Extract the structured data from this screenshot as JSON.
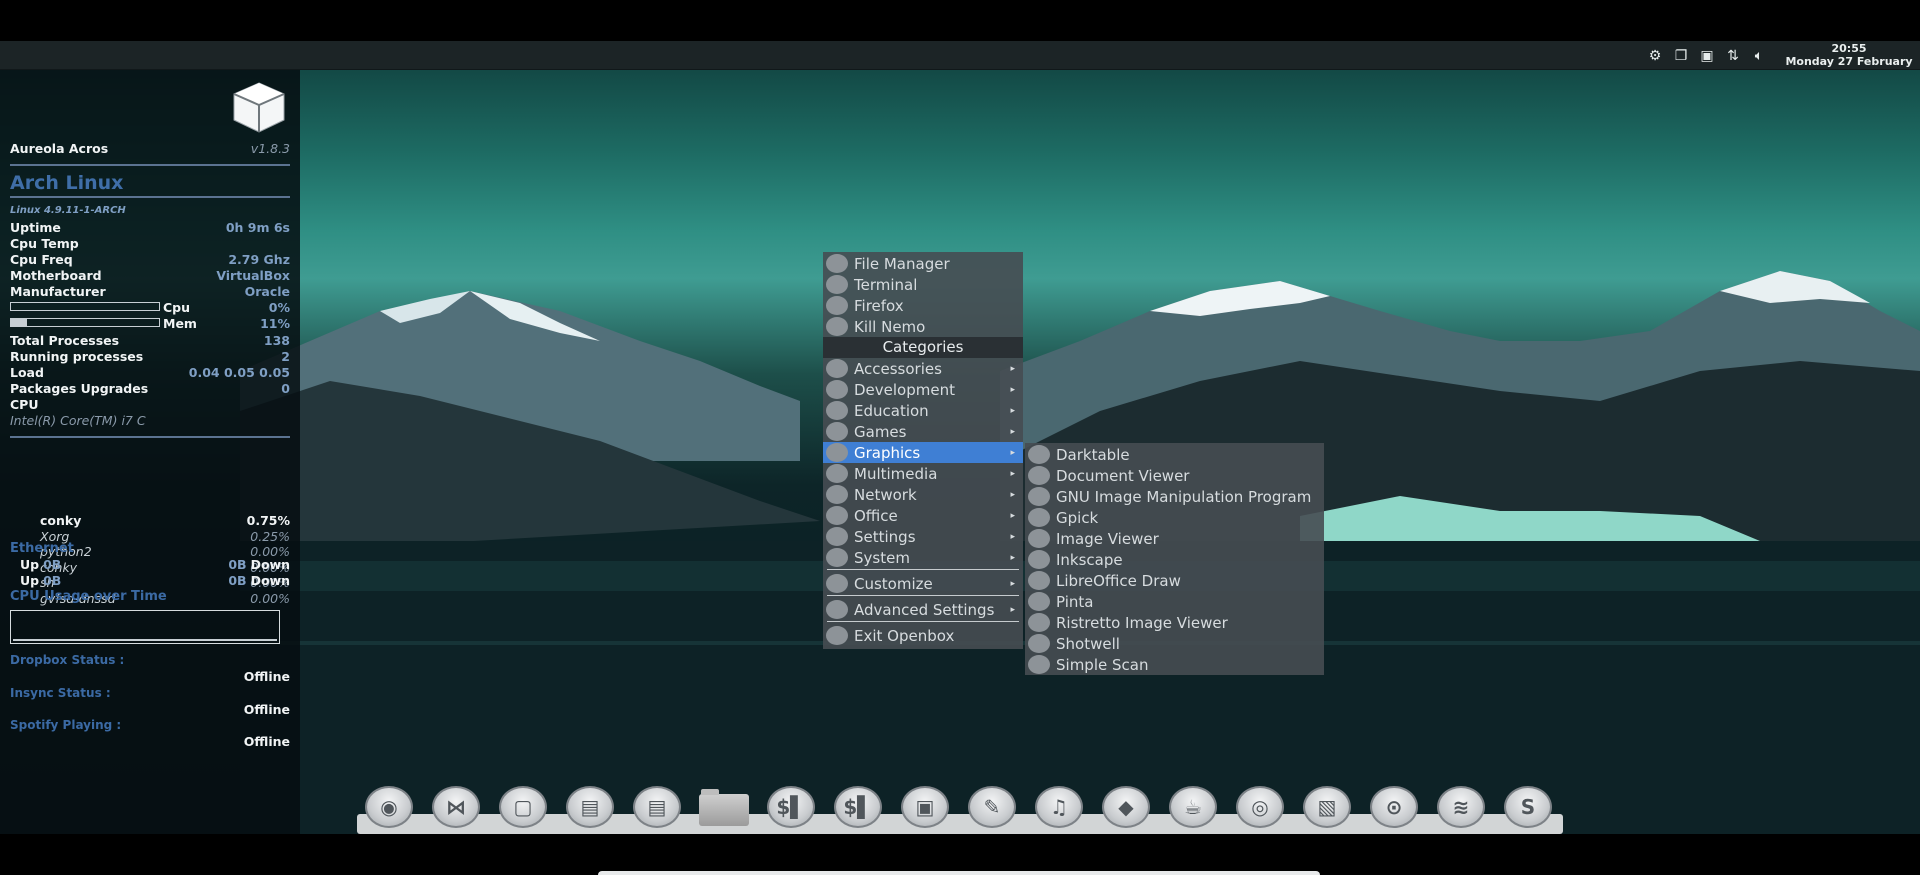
{
  "panel": {
    "clock_time": "20:55",
    "clock_date": "Monday 27 February",
    "tray_icons": [
      "gear-icon",
      "clipboard-icon",
      "image-icon",
      "network-arrows-icon",
      "volume-icon"
    ]
  },
  "conky": {
    "title": "Aureola Acros",
    "version": "v1.8.3",
    "os": "Arch Linux",
    "kernel": "Linux 4.9.11-1-ARCH",
    "uptime_label": "Uptime",
    "uptime": "0h 9m 6s",
    "cputemp_label": "Cpu Temp",
    "cpufreq_label": "Cpu Freq",
    "cpufreq": "2.79 Ghz",
    "motherboard_label": "Motherboard",
    "motherboard": "VirtualBox",
    "manufacturer_label": "Manufacturer",
    "manufacturer": "Oracle",
    "cpu_label": "Cpu",
    "cpu_val": "0%",
    "cpu_fill": 0,
    "mem_label": "Mem",
    "mem_val": "11%",
    "mem_fill": 11,
    "total_proc_label": "Total Processes",
    "total_proc": "138",
    "running_proc_label": "Running processes",
    "running_proc": "2",
    "load_label": "Load",
    "load": "0.04 0.05 0.05",
    "pkg_label": "Packages Upgrades",
    "pkg": "0",
    "cpu_section": "CPU",
    "cpu_model": "Intel(R) Core(TM) i7 C",
    "procs": [
      {
        "name": "conky",
        "val": "0.75%"
      },
      {
        "name": "Xorg",
        "val": "0.25%"
      },
      {
        "name": "python2",
        "val": "0.00%"
      },
      {
        "name": "conky",
        "val": "0.00%"
      },
      {
        "name": "sh",
        "val": "0.00%"
      },
      {
        "name": "gvfsd-dnssd",
        "val": "0.00%"
      }
    ],
    "eth_section": "Ethernet",
    "up_label": "Up",
    "up_val": "0B",
    "down_val": "0B",
    "down_label": "Down",
    "cpu_usage_title": "CPU Usage over Time",
    "dropbox_label": "Dropbox Status :",
    "dropbox": "Offline",
    "insync_label": "Insync Status :",
    "insync": "Offline",
    "spotify_label": "Spotify Playing :",
    "spotify": "Offline"
  },
  "menu": {
    "top": [
      "File Manager",
      "Terminal",
      "Firefox",
      "Kill Nemo"
    ],
    "header": "Categories",
    "categories": [
      "Accessories",
      "Development",
      "Education",
      "Games",
      "Graphics",
      "Multimedia",
      "Network",
      "Office",
      "Settings",
      "System"
    ],
    "active": "Graphics",
    "customize": "Customize",
    "advanced": "Advanced Settings",
    "exit": "Exit Openbox"
  },
  "submenu": {
    "items": [
      "Darktable",
      "Document Viewer",
      "GNU Image Manipulation Program",
      "Gpick",
      "Image Viewer",
      "Inkscape",
      "LibreOffice Draw",
      "Pinta",
      "Ristretto Image Viewer",
      "Shotwell",
      "Simple Scan"
    ]
  },
  "dock": {
    "icons": [
      "firefox-icon",
      "bow-icon",
      "window-icon",
      "box-icon",
      "box-icon",
      "folder-icon",
      "terminal-icon",
      "terminal-icon",
      "image-viewer-icon",
      "pencil-icon",
      "music-icon",
      "inkscape-icon",
      "gimp-icon",
      "shotwell-icon",
      "screenshot-icon",
      "camera-icon",
      "spotify-icon",
      "sublime-icon"
    ],
    "glyphs": [
      "◉",
      "⋈",
      "▢",
      "▤",
      "▤",
      "",
      "$▌",
      "$▌",
      "▣",
      "✎",
      "♫",
      "◆",
      "☕",
      "◎",
      "▧",
      "⊙",
      "≋",
      "S"
    ]
  }
}
